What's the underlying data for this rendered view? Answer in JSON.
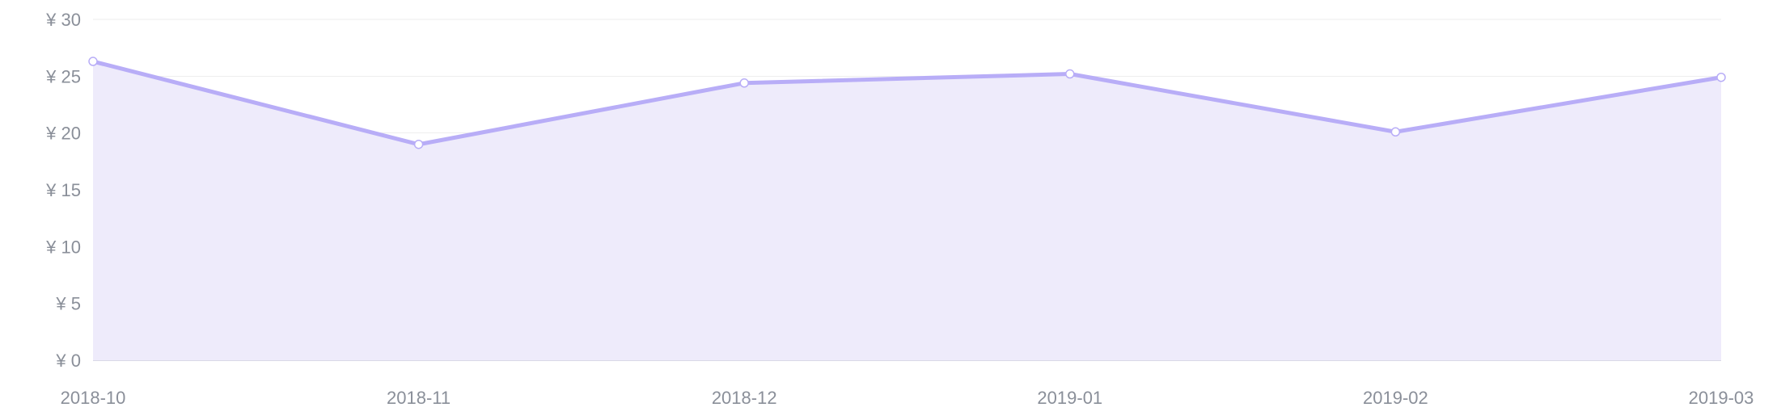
{
  "chart_data": {
    "type": "area",
    "title": "",
    "xlabel": "",
    "ylabel": "",
    "categories": [
      "2018-10",
      "2018-11",
      "2018-12",
      "2019-01",
      "2019-02",
      "2019-03"
    ],
    "series": [
      {
        "values": [
          26.3,
          19.0,
          24.4,
          25.2,
          20.1,
          24.9
        ]
      }
    ],
    "ylim": [
      0,
      30
    ],
    "yticks": [
      0,
      5,
      10,
      15,
      20,
      25,
      30
    ],
    "ytick_labels": [
      "¥ 0",
      "¥ 5",
      "¥ 10",
      "¥ 15",
      "¥ 20",
      "¥ 25",
      "¥ 30"
    ],
    "grid": true,
    "legend": "none",
    "colors": {
      "line": "#b8adf7",
      "area": "#eeebfb",
      "point_fill": "#ffffff",
      "tick_text": "#8a8f99",
      "grid": "#eeeeee",
      "axis": "#d9d9e6"
    }
  }
}
